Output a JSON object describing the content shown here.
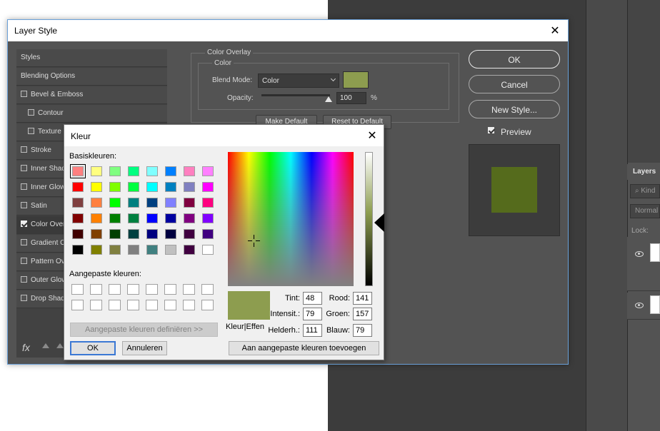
{
  "layer_style": {
    "title": "Layer Style",
    "sidebar": {
      "items": [
        {
          "label": "Styles",
          "checkbox": false,
          "checked": false
        },
        {
          "label": "Blending Options",
          "checkbox": false,
          "checked": false
        },
        {
          "label": "Bevel & Emboss",
          "checkbox": true,
          "checked": false
        },
        {
          "label": "Contour",
          "checkbox": true,
          "checked": false
        },
        {
          "label": "Texture",
          "checkbox": true,
          "checked": false
        },
        {
          "label": "Stroke",
          "checkbox": true,
          "checked": false
        },
        {
          "label": "Inner Shadow",
          "checkbox": true,
          "checked": false
        },
        {
          "label": "Inner Glow",
          "checkbox": true,
          "checked": false
        },
        {
          "label": "Satin",
          "checkbox": true,
          "checked": false
        },
        {
          "label": "Color Overlay",
          "checkbox": true,
          "checked": true
        },
        {
          "label": "Gradient Overlay",
          "checkbox": true,
          "checked": false
        },
        {
          "label": "Pattern Overlay",
          "checkbox": true,
          "checked": false
        },
        {
          "label": "Outer Glow",
          "checkbox": true,
          "checked": false
        },
        {
          "label": "Drop Shadow",
          "checkbox": true,
          "checked": false
        }
      ],
      "fx_label": "fx"
    },
    "color_overlay": {
      "group_label": "Color Overlay",
      "color_label": "Color",
      "blend_mode_label": "Blend Mode:",
      "blend_mode_value": "Color",
      "overlay_color": "#8d9d4f",
      "opacity_label": "Opacity:",
      "opacity_value": "100",
      "opacity_unit": "%",
      "make_default_label": "Make Default",
      "reset_default_label": "Reset to Default"
    },
    "buttons": {
      "ok": "OK",
      "cancel": "Cancel",
      "new_style": "New Style..."
    },
    "preview_label": "Preview",
    "preview_checked": true,
    "preview_color": "#556b1c"
  },
  "kleur": {
    "title": "Kleur",
    "basic_colors_label": "Basiskleuren:",
    "basic_colors": [
      "#ff8080",
      "#ffff80",
      "#80ff80",
      "#00ff80",
      "#80ffff",
      "#0080ff",
      "#ff80c0",
      "#ff80ff",
      "#ff0000",
      "#ffff00",
      "#80ff00",
      "#00ff40",
      "#00ffff",
      "#0080c0",
      "#8080c0",
      "#ff00ff",
      "#804040",
      "#ff8040",
      "#00ff00",
      "#008080",
      "#004080",
      "#8080ff",
      "#800040",
      "#ff0080",
      "#800000",
      "#ff8000",
      "#008000",
      "#008040",
      "#0000ff",
      "#0000a0",
      "#800080",
      "#8000ff",
      "#400000",
      "#804000",
      "#004000",
      "#004040",
      "#000080",
      "#000040",
      "#400040",
      "#400080",
      "#000000",
      "#808000",
      "#808040",
      "#808080",
      "#408080",
      "#c0c0c0",
      "#400040",
      "#ffffff"
    ],
    "selected_index": 0,
    "custom_colors_label": "Aangepaste kleuren:",
    "define_button": "Aangepaste kleuren definiëren >>",
    "ok_button": "OK",
    "cancel_button": "Annuleren",
    "preview_label": "Kleur|Effen",
    "current_color": "#8d9d4f",
    "fields": {
      "tint_label": "Tint:",
      "tint": "48",
      "intensity_label": "Intensit.:",
      "intensity": "79",
      "brightness_label": "Helderh.:",
      "brightness": "111",
      "red_label": "Rood:",
      "red": "141",
      "green_label": "Groen:",
      "green": "157",
      "blue_label": "Blauw:",
      "blue": "79"
    },
    "add_custom_button": "Aan aangepaste kleuren toevoegen"
  },
  "layers_panel": {
    "tab_label": "Layers",
    "kind_placeholder": "Kind",
    "blend_value": "Normal",
    "lock_label": "Lock:"
  }
}
